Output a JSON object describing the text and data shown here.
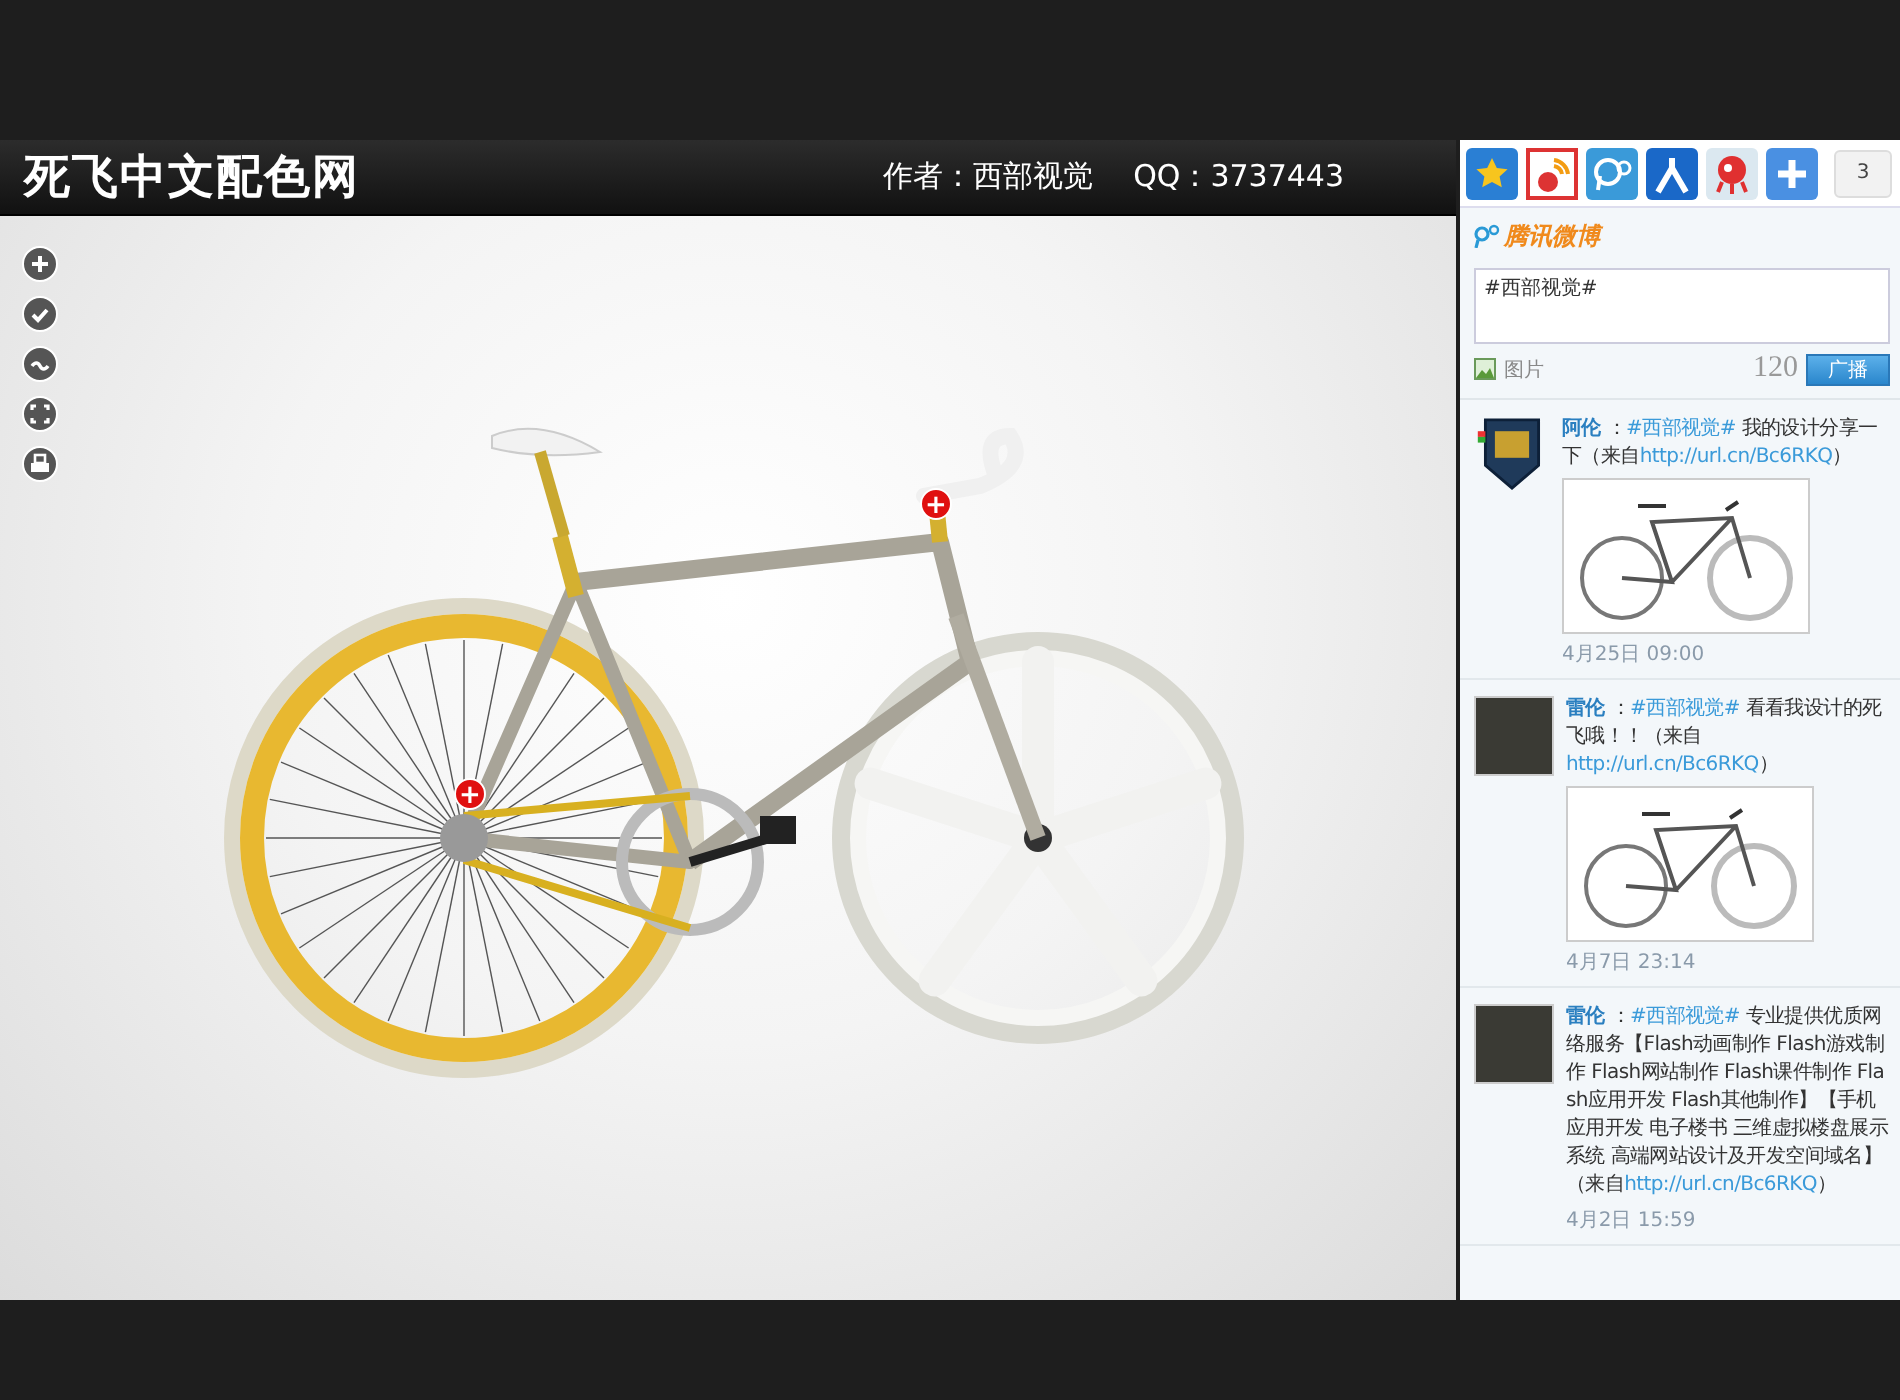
{
  "header": {
    "site_title": "死飞中文配色网",
    "author": "作者：西部视觉",
    "qq": "QQ：3737443"
  },
  "tools": [
    {
      "kind": "zoom-in"
    },
    {
      "kind": "check"
    },
    {
      "kind": "wave"
    },
    {
      "kind": "fullscreen"
    },
    {
      "kind": "print"
    }
  ],
  "hotspots": [
    {
      "label": "+"
    },
    {
      "label": "+"
    }
  ],
  "share": {
    "count": "3",
    "icons": [
      {
        "kind": "star"
      },
      {
        "kind": "rss"
      },
      {
        "kind": "p"
      },
      {
        "kind": "person"
      },
      {
        "kind": "fish"
      },
      {
        "kind": "plus"
      }
    ]
  },
  "weibo": {
    "brand": "腾讯微博",
    "value": "#西部视觉#",
    "image_label": "图片",
    "remaining": "120",
    "submit": "广播"
  },
  "posts": [
    {
      "kind": "badge",
      "author": "阿伦",
      "sep": "：",
      "topic": "#西部视觉#",
      "text": "我的设计分享一下",
      "source_open": "（来自",
      "url": "http://url.cn/Bc6RKQ",
      "source_close": "）",
      "image": true,
      "time": "4月25日 09:00"
    },
    {
      "kind": "photo",
      "author": "雷伦",
      "sep": "：",
      "topic": "#西部视觉#",
      "text": "看看我设计的死飞哦！！",
      "source_open": "（来自",
      "url": "http://url.cn/Bc6RKQ",
      "source_close": "）",
      "image": true,
      "time": "4月7日 23:14"
    },
    {
      "kind": "photo",
      "author": "雷伦",
      "sep": "：",
      "topic": "#西部视觉#",
      "text": "专业提供优质网络服务【Flash动画制作 Flash游戏制作 Flash网站制作 Flash课件制作 Flash应用开发 Flash其他制作】【手机应用开发 电子楼书 三维虚拟楼盘展示系统 高端网站设计及开发空间域名】",
      "source_open": "（来自",
      "url": "http://url.cn/Bc6RKQ",
      "source_close": "）",
      "image": false,
      "time": "4月2日 15:59"
    }
  ]
}
